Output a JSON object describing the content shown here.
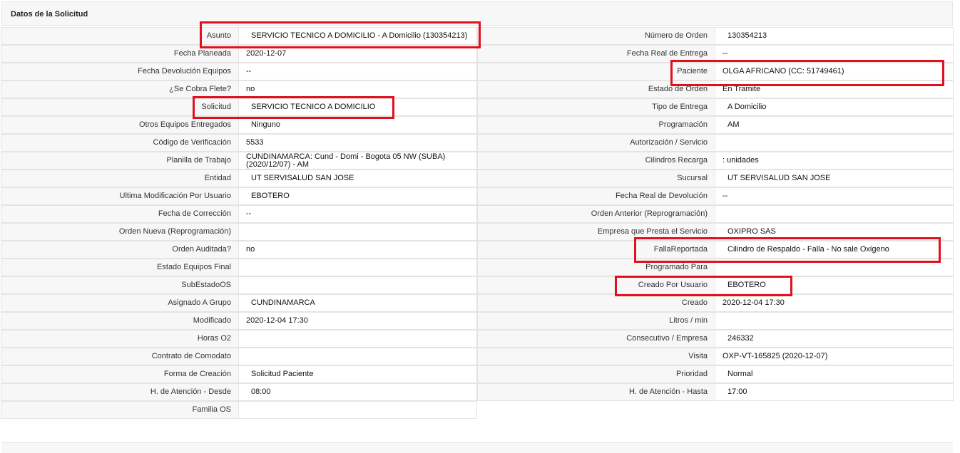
{
  "panel": {
    "title": "Datos de la Solicitud"
  },
  "left_rows": [
    {
      "label": "Asunto",
      "value": "SERVICIO TECNICO A DOMICILIO - A Domicilio (130354213)"
    },
    {
      "label": "Fecha Planeada",
      "value": "2020-12-07"
    },
    {
      "label": "Fecha Devolución Equipos",
      "value": "--"
    },
    {
      "label": "¿Se Cobra Flete?",
      "value": "no"
    },
    {
      "label": "Solicitud",
      "value": "SERVICIO TECNICO A DOMICILIO"
    },
    {
      "label": "Otros Equipos Entregados",
      "value": "Ninguno"
    },
    {
      "label": "Código de Verificación",
      "value": "5533"
    },
    {
      "label": "Planilla de Trabajo",
      "value": "CUNDINAMARCA: Cund - Domi - Bogota 05 NW (SUBA) (2020/12/07) - AM"
    },
    {
      "label": "Entidad",
      "value": "UT SERVISALUD SAN JOSE"
    },
    {
      "label": "Ultima Modificación Por Usuario",
      "value": "EBOTERO"
    },
    {
      "label": "Fecha de Corrección",
      "value": "--"
    },
    {
      "label": "Orden Nueva (Reprogramación)",
      "value": ""
    },
    {
      "label": "Orden Auditada?",
      "value": "no"
    },
    {
      "label": "Estado Equipos Final",
      "value": ""
    },
    {
      "label": "SubEstadoOS",
      "value": ""
    },
    {
      "label": "Asignado A Grupo",
      "value": "CUNDINAMARCA"
    },
    {
      "label": "Modificado",
      "value": "2020-12-04 17:30"
    },
    {
      "label": "Horas O2",
      "value": ""
    },
    {
      "label": "Contrato de Comodato",
      "value": ""
    },
    {
      "label": "Forma de Creación",
      "value": "Solicitud Paciente"
    },
    {
      "label": "H. de Atención - Desde",
      "value": "08:00"
    },
    {
      "label": "Familia OS",
      "value": ""
    }
  ],
  "right_rows": [
    {
      "label": "Número de Orden",
      "value": "130354213"
    },
    {
      "label": "Fecha Real de Entrega",
      "value": "--"
    },
    {
      "label": "Paciente",
      "value": "OLGA AFRICANO (CC: 51749461)"
    },
    {
      "label": "Estado de Orden",
      "value": "En Tramite"
    },
    {
      "label": "Tipo de Entrega",
      "value": "A Domicilio"
    },
    {
      "label": "Programación",
      "value": "AM"
    },
    {
      "label": "Autorización / Servicio",
      "value": ""
    },
    {
      "label": "Cilindros Recarga",
      "value": ": unidades"
    },
    {
      "label": "Sucursal",
      "value": "UT SERVISALUD SAN JOSE"
    },
    {
      "label": "Fecha Real de Devolución",
      "value": "--"
    },
    {
      "label": "Orden Anterior (Reprogramación)",
      "value": ""
    },
    {
      "label": "Empresa que Presta el Servicio",
      "value": "OXIPRO SAS"
    },
    {
      "label": "FallaReportada",
      "value": "Cilindro de Respaldo - Falla - No sale Oxigeno"
    },
    {
      "label": "Programado Para",
      "value": ""
    },
    {
      "label": "Creado Por Usuario",
      "value": "EBOTERO"
    },
    {
      "label": "Creado",
      "value": "2020-12-04 17:30"
    },
    {
      "label": "Litros / min",
      "value": ""
    },
    {
      "label": "Consecutivo / Empresa",
      "value": "246332"
    },
    {
      "label": "Visita",
      "value": "OXP-VT-165825 (2020-12-07)"
    },
    {
      "label": "Prioridad",
      "value": "Normal"
    },
    {
      "label": "H. de Atención - Hasta",
      "value": "17:00"
    }
  ],
  "highlight_color": "#e0101e"
}
